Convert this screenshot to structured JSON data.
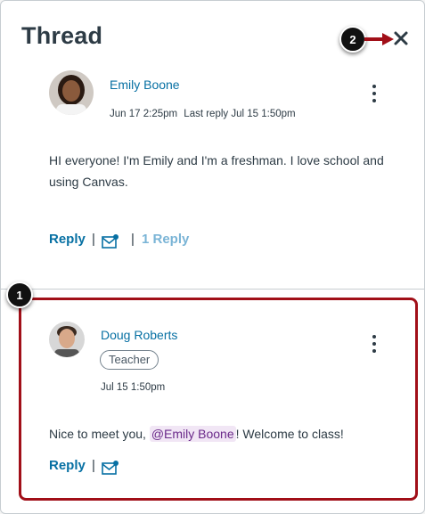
{
  "panel": {
    "title": "Thread"
  },
  "callouts": {
    "first": "1",
    "second": "2"
  },
  "parent_post": {
    "author": "Emily Boone",
    "date": "Jun 17 2:25pm",
    "last_reply_label": "Last reply",
    "last_reply_date": "Jul 15 1:50pm",
    "body": "HI everyone! I'm Emily and I'm a freshman. I love school and using Canvas.",
    "reply_label": "Reply",
    "separator": "|",
    "replies_count_label": "1 Reply"
  },
  "reply_post": {
    "author": "Doug Roberts",
    "role": "Teacher",
    "date": "Jul 15 1:50pm",
    "body_before": "Nice to meet you, ",
    "mention": "@Emily Boone",
    "body_after": "! Welcome to class!",
    "reply_label": "Reply",
    "separator": "|"
  },
  "colors": {
    "link": "#0770a3",
    "highlight_border": "#a10f18",
    "mention_bg": "#f1e6f5",
    "muted_link": "#7ab4d6"
  },
  "icons": [
    "close-icon",
    "kebab-menu-icon",
    "mark-unread-mail-icon"
  ]
}
